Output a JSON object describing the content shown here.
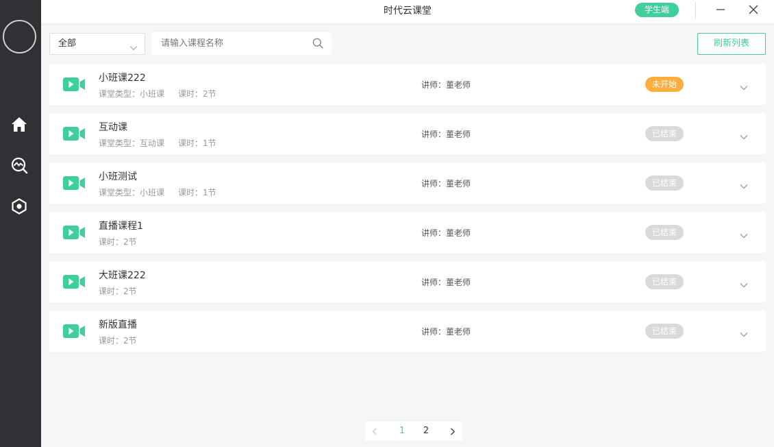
{
  "app": {
    "title": "时代云课堂",
    "role_badge": "学生端"
  },
  "colors": {
    "accent": "#3fcf9b",
    "pending": "#ffae3d",
    "ended": "#d9d9d9",
    "sidebar_bg": "#303135"
  },
  "sidebar": {
    "items": [
      {
        "icon": "home-icon"
      },
      {
        "icon": "search-analytics-icon"
      },
      {
        "icon": "settings-hexagon-icon"
      }
    ]
  },
  "toolbar": {
    "filter_value": "全部",
    "search_placeholder": "请输入课程名称",
    "search_value": "",
    "refresh_label": "刷新列表"
  },
  "courses": [
    {
      "name": "小班课222",
      "type_label": "课堂类型：小班课",
      "hours_label": "课时：2节",
      "teacher": "讲师：董老师",
      "status": "未开始",
      "state": "pending"
    },
    {
      "name": "互动课",
      "type_label": "课堂类型：互动课",
      "hours_label": "课时：1节",
      "teacher": "讲师：董老师",
      "status": "已结束",
      "state": "ended"
    },
    {
      "name": "小班测试",
      "type_label": "课堂类型：小班课",
      "hours_label": "课时：1节",
      "teacher": "讲师：董老师",
      "status": "已结束",
      "state": "ended"
    },
    {
      "name": "直播课程1",
      "type_label": "",
      "hours_label": "课时：2节",
      "teacher": "讲师：董老师",
      "status": "已结束",
      "state": "ended"
    },
    {
      "name": "大班课222",
      "type_label": "",
      "hours_label": "课时：2节",
      "teacher": "讲师：董老师",
      "status": "已结束",
      "state": "ended"
    },
    {
      "name": "新版直播",
      "type_label": "",
      "hours_label": "课时：2节",
      "teacher": "讲师：董老师",
      "status": "已结束",
      "state": "ended"
    }
  ],
  "pagination": {
    "pages": [
      "1",
      "2"
    ],
    "current": "1"
  }
}
